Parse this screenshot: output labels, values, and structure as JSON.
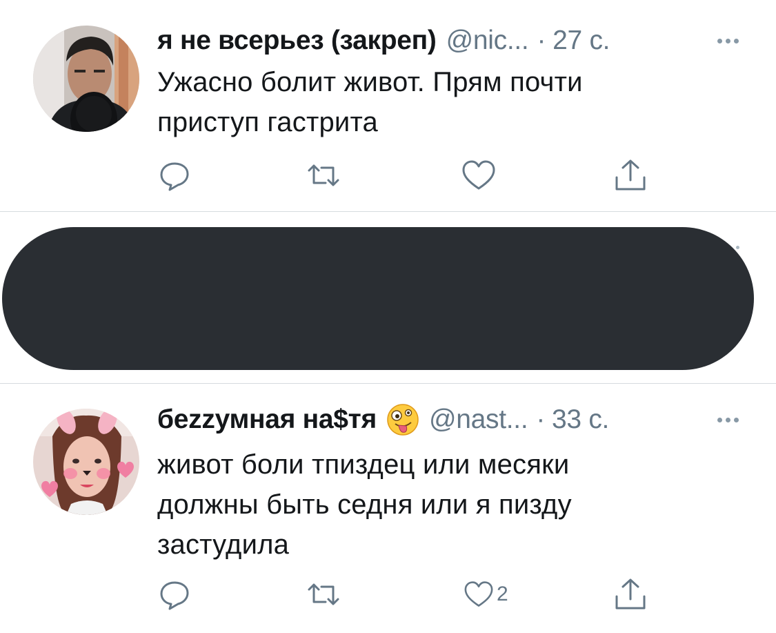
{
  "tweets": [
    {
      "name": "я не всерьез (закреп)",
      "handle": "@nic...",
      "separator": "·",
      "time": "27 с.",
      "text_lines": [
        "Ужасно болит живот. Прям почти",
        "приступ гастрита"
      ],
      "like_count": "",
      "avatar": "avatar-man-microphone"
    },
    {
      "name": "беzzумная на$тя",
      "emoji": "zany-face-emoji",
      "handle": "@nast...",
      "separator": "·",
      "time": "33 с.",
      "text_lines": [
        "живот боли тпиздец или месяки",
        "должны быть седня или я пизду",
        "застудила"
      ],
      "like_count": "2",
      "avatar": "avatar-girl-bunny-filter"
    }
  ],
  "icons": {
    "reply": "reply-icon",
    "retweet": "retweet-icon",
    "like": "heart-icon",
    "share": "share-icon",
    "more": "more-icon"
  },
  "colors": {
    "text": "#14171a",
    "secondary": "#657786",
    "icon": "#657786",
    "divider": "#d6dbdf",
    "redaction": "#2a2e33"
  }
}
